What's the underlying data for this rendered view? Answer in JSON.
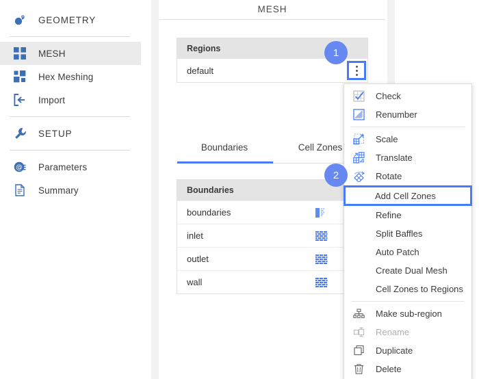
{
  "colors": {
    "accent": "#4a7bf7",
    "badge": "#6688f0",
    "icon_blue": "#3d6fb5",
    "header_gray": "#e4e4e4",
    "selected_gray": "#ebebeb"
  },
  "sidebar": {
    "items": [
      {
        "label": "GEOMETRY",
        "icon": "geometry-icon",
        "type": "header",
        "selected": false
      },
      {
        "divider": true
      },
      {
        "label": "MESH",
        "icon": "mesh-grid-icon",
        "type": "item",
        "selected": true
      },
      {
        "label": "Hex Meshing",
        "icon": "hex-meshing-icon",
        "type": "item",
        "selected": false
      },
      {
        "label": "Import",
        "icon": "import-icon",
        "type": "item",
        "selected": false
      },
      {
        "divider": true
      },
      {
        "label": "SETUP",
        "icon": "wrench-icon",
        "type": "header",
        "selected": false
      },
      {
        "divider": true
      },
      {
        "label": "Parameters",
        "icon": "parameters-icon",
        "type": "item",
        "selected": false
      },
      {
        "label": "Summary",
        "icon": "summary-document-icon",
        "type": "item",
        "selected": false
      }
    ]
  },
  "main": {
    "title": "MESH",
    "regions": {
      "header": "Regions",
      "rows": [
        {
          "name": "default"
        }
      ],
      "kebab_label": "more-options"
    },
    "tabs": [
      {
        "label": "Boundaries",
        "active": true
      },
      {
        "label": "Cell Zones",
        "active": false
      }
    ],
    "boundaries": {
      "header": "Boundaries",
      "rows": [
        {
          "name": "boundaries",
          "icon": "boundary-group-icon"
        },
        {
          "name": "inlet",
          "icon": "brick-wall-icon"
        },
        {
          "name": "outlet",
          "icon": "brick-wall-icon"
        },
        {
          "name": "wall",
          "icon": "brick-wall-icon"
        }
      ]
    }
  },
  "badges": [
    {
      "text": "1"
    },
    {
      "text": "2"
    }
  ],
  "context_menu": {
    "items": [
      {
        "label": "Check",
        "icon": "check-grid-icon",
        "disabled": false,
        "highlight": false,
        "has_icon": true
      },
      {
        "label": "Renumber",
        "icon": "renumber-icon",
        "disabled": false,
        "highlight": false,
        "has_icon": true
      },
      {
        "separator": true
      },
      {
        "label": "Scale",
        "icon": "scale-icon",
        "disabled": false,
        "highlight": false,
        "has_icon": true
      },
      {
        "label": "Translate",
        "icon": "translate-icon",
        "disabled": false,
        "highlight": false,
        "has_icon": true
      },
      {
        "label": "Rotate",
        "icon": "rotate-icon",
        "disabled": false,
        "highlight": false,
        "has_icon": true
      },
      {
        "label": "Add Cell Zones",
        "icon": null,
        "disabled": false,
        "highlight": true,
        "has_icon": false
      },
      {
        "label": "Refine",
        "icon": null,
        "disabled": false,
        "highlight": false,
        "has_icon": false
      },
      {
        "label": "Split Baffles",
        "icon": null,
        "disabled": false,
        "highlight": false,
        "has_icon": false
      },
      {
        "label": "Auto Patch",
        "icon": null,
        "disabled": false,
        "highlight": false,
        "has_icon": false
      },
      {
        "label": "Create Dual Mesh",
        "icon": null,
        "disabled": false,
        "highlight": false,
        "has_icon": false
      },
      {
        "label": "Cell Zones to Regions",
        "icon": null,
        "disabled": false,
        "highlight": false,
        "has_icon": false
      },
      {
        "separator": true
      },
      {
        "label": "Make sub-region",
        "icon": "sub-region-icon",
        "disabled": false,
        "highlight": false,
        "has_icon": true
      },
      {
        "label": "Rename",
        "icon": "rename-icon",
        "disabled": true,
        "highlight": false,
        "has_icon": true
      },
      {
        "label": "Duplicate",
        "icon": "duplicate-icon",
        "disabled": false,
        "highlight": false,
        "has_icon": true
      },
      {
        "label": "Delete",
        "icon": "trash-icon",
        "disabled": false,
        "highlight": false,
        "has_icon": true
      }
    ]
  }
}
